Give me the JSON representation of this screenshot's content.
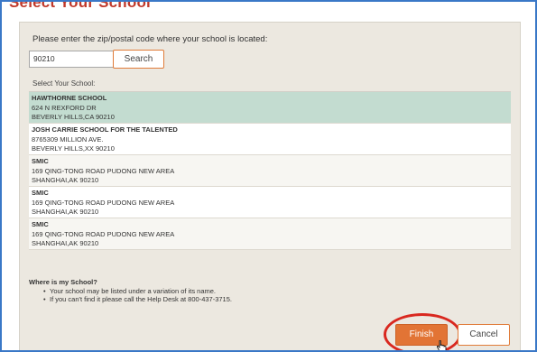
{
  "dialog": {
    "title": "Select Your School"
  },
  "form": {
    "prompt": "Please enter the zip/postal code where your school is located:",
    "zip_value": "90210",
    "search_label": "Search",
    "select_label": "Select Your School:"
  },
  "schools": [
    {
      "name": "HAWTHORNE SCHOOL",
      "address": "624 N REXFORD DR",
      "city": "BEVERLY HILLS,CA 90210",
      "selected": true
    },
    {
      "name": "JOSH CARRIE SCHOOL FOR THE TALENTED",
      "address": "8765309 MILLION AVE.",
      "city": "BEVERLY HILLS,XX 90210",
      "selected": false
    },
    {
      "name": "SMIC",
      "address": "169 QING-TONG ROAD PUDONG NEW AREA",
      "city": "SHANGHAI,AK 90210",
      "selected": false
    },
    {
      "name": "SMIC",
      "address": "169 QING-TONG ROAD PUDONG NEW AREA",
      "city": "SHANGHAI,AK 90210",
      "selected": false
    },
    {
      "name": "SMIC",
      "address": "169 QING-TONG ROAD PUDONG NEW AREA",
      "city": "SHANGHAI,AK 90210",
      "selected": false
    }
  ],
  "help": {
    "title": "Where is my School?",
    "tips": [
      "Your school may be listed under a variation of its name.",
      "If you can't find it please call the Help Desk at 800-437-3715."
    ]
  },
  "buttons": {
    "finish_label": "Finish",
    "cancel_label": "Cancel"
  },
  "colors": {
    "accent": "#e27435",
    "selected_row": "#c3dcd0",
    "panel_bg": "#ece8e0",
    "frame_border": "#3a78c7",
    "highlight_ring": "#d9281f"
  },
  "icons": {
    "cursor": "hand-pointer-icon"
  }
}
